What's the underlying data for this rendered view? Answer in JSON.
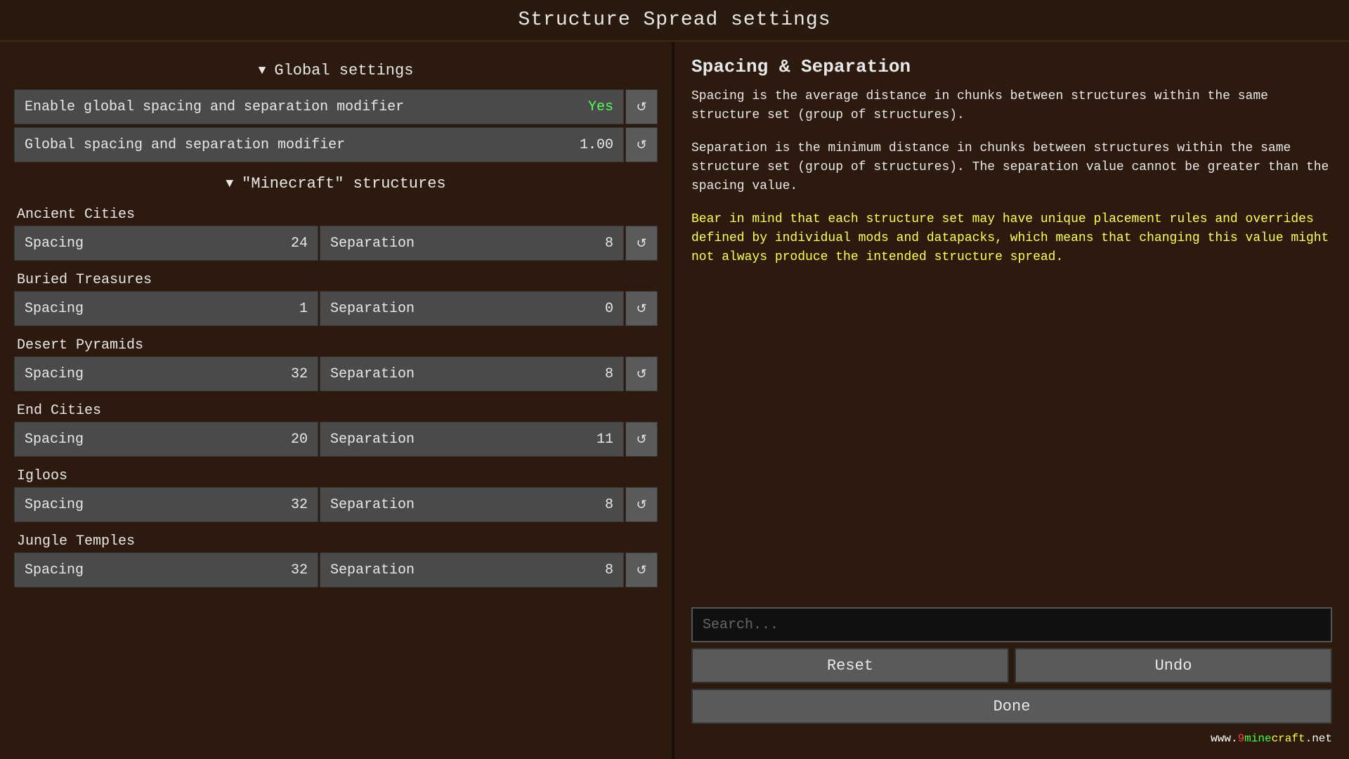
{
  "title": "Structure Spread settings",
  "left_panel": {
    "global_section": {
      "label": "Global settings",
      "icon": "▼",
      "rows": [
        {
          "label": "Enable global spacing and separation modifier",
          "value": "Yes",
          "value_type": "yes"
        },
        {
          "label": "Global spacing and separation modifier",
          "value": "1.00",
          "value_type": "number"
        }
      ]
    },
    "minecraft_section": {
      "label": "\"Minecraft\" structures",
      "icon": "▼",
      "structures": [
        {
          "name": "Ancient Cities",
          "spacing": 24,
          "separation": 8
        },
        {
          "name": "Buried Treasures",
          "spacing": 1,
          "separation": 0
        },
        {
          "name": "Desert Pyramids",
          "spacing": 32,
          "separation": 8
        },
        {
          "name": "End Cities",
          "spacing": 20,
          "separation": 11
        },
        {
          "name": "Igloos",
          "spacing": 32,
          "separation": 8
        },
        {
          "name": "Jungle Temples",
          "spacing": 32,
          "separation": 8
        }
      ]
    }
  },
  "right_panel": {
    "info_title": "Spacing & Separation",
    "info_text_1": "Spacing is the average distance in chunks between structures within the same structure set (group of structures).",
    "info_text_2": "Separation is the minimum distance in chunks between structures within the same structure set (group of structures). The separation value cannot be greater than the spacing value.",
    "info_warning": "Bear in mind that each structure set may have unique placement rules and overrides defined by individual mods and datapacks, which means that changing this value might not always produce the intended structure spread.",
    "search_placeholder": "Search...",
    "reset_label": "Reset",
    "undo_label": "Undo",
    "done_label": "Done",
    "watermark": "www.9minecraft.net"
  },
  "labels": {
    "spacing": "Spacing",
    "separation": "Separation",
    "reset_icon": "↺"
  }
}
